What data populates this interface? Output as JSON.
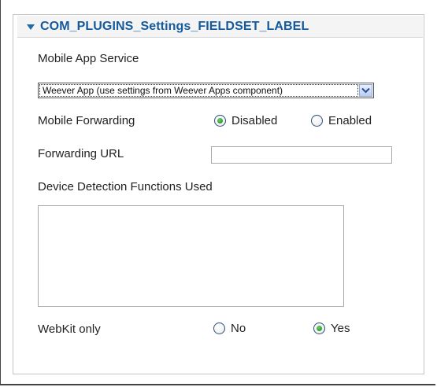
{
  "fieldset": {
    "title": "COM_PLUGINS_Settings_FIELDSET_LABEL"
  },
  "mobile_app_service": {
    "label": "Mobile App Service",
    "selected": "Weever App (use settings from Weever Apps component)"
  },
  "mobile_forwarding": {
    "label": "Mobile Forwarding",
    "options": [
      {
        "label": "Disabled",
        "checked": true
      },
      {
        "label": "Enabled",
        "checked": false
      }
    ]
  },
  "forwarding_url": {
    "label": "Forwarding URL",
    "value": ""
  },
  "device_detection": {
    "label": "Device Detection Functions Used",
    "value": ""
  },
  "webkit_only": {
    "label": "WebKit only",
    "options": [
      {
        "label": "No",
        "checked": false
      },
      {
        "label": "Yes",
        "checked": true
      }
    ]
  },
  "colors": {
    "legend_title": "#145a9c",
    "radio_checked": "#2b9a2b",
    "fieldset_border": "#c4c4c4"
  }
}
